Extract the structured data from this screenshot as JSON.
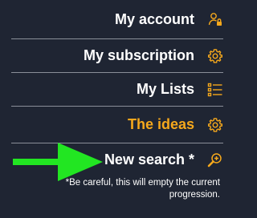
{
  "menu": {
    "items": [
      {
        "label": "My account",
        "icon": "user-lock-icon",
        "active": false
      },
      {
        "label": "My subscription",
        "icon": "gear-icon",
        "active": false
      },
      {
        "label": "My Lists",
        "icon": "list-icon",
        "active": false
      },
      {
        "label": "The ideas",
        "icon": "gear-icon",
        "active": true
      },
      {
        "label": "New search *",
        "icon": "search-plus-icon",
        "active": false
      }
    ],
    "note": "*Be careful, this will empty the current progression."
  },
  "colors": {
    "background": "#1f2533",
    "accent": "#f5a81c",
    "arrow": "#22e622",
    "divider": "#8a8f99"
  }
}
